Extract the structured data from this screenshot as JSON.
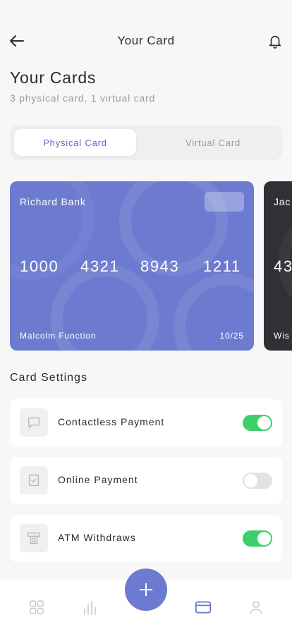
{
  "header": {
    "title": "Your Card",
    "back_icon": "arrow-left-icon",
    "notification_icon": "bell-icon"
  },
  "page": {
    "title": "Your Cards",
    "subtitle": "3 physical card, 1 virtual card"
  },
  "tabs": [
    {
      "label": "Physical Card",
      "active": true
    },
    {
      "label": "Virtual Card",
      "active": false
    }
  ],
  "cards": [
    {
      "holder": "Richard Bank",
      "number_groups": [
        "1000",
        "4321",
        "8943",
        "1211"
      ],
      "owner": "Malcolm Function",
      "expiry": "10/25",
      "color": "#6c7bd0"
    },
    {
      "holder": "Jac",
      "number_start": "43",
      "owner": "Wis",
      "color": "#2f3136"
    }
  ],
  "settings": {
    "title": "Card Settings",
    "items": [
      {
        "label": "Contactless Payment",
        "icon": "chat-bubble-icon",
        "enabled": true
      },
      {
        "label": "Online Payment",
        "icon": "receipt-check-icon",
        "enabled": false
      },
      {
        "label": "ATM Withdraws",
        "icon": "atm-icon",
        "enabled": true
      }
    ]
  },
  "bottom_nav": {
    "items": [
      {
        "icon": "grid-icon",
        "active": false
      },
      {
        "icon": "bar-chart-icon",
        "active": false
      },
      {
        "icon": "plus-icon",
        "active": true
      },
      {
        "icon": "card-icon",
        "active": true
      },
      {
        "icon": "user-icon",
        "active": false
      }
    ]
  },
  "colors": {
    "accent": "#6c7bd0",
    "toggle_on": "#3ecf6d",
    "toggle_off": "#e2e2e2",
    "background": "#f7f7f7"
  }
}
